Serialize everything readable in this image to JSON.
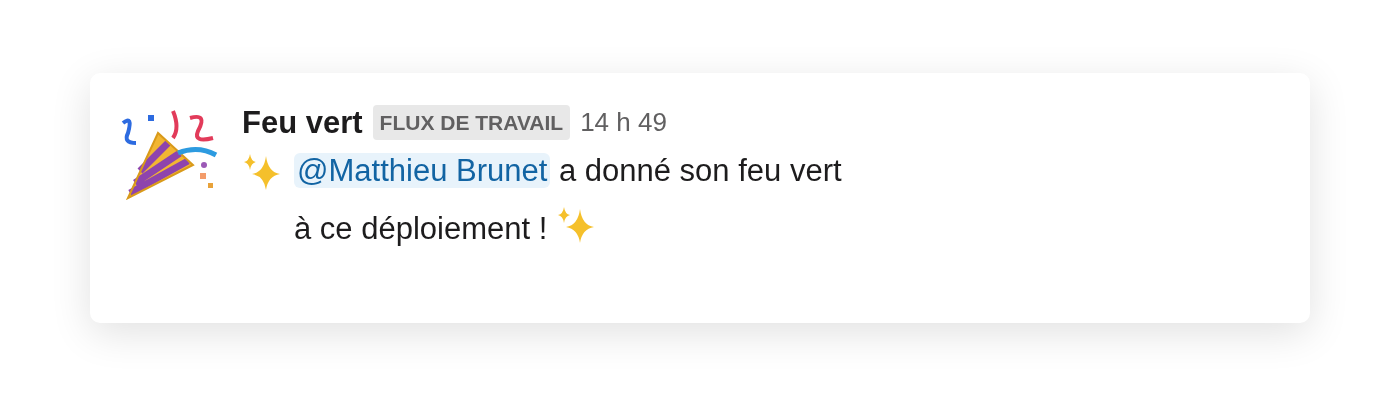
{
  "message": {
    "sender": "Feu vert",
    "badge": "FLUX DE TRAVAIL",
    "time": "14 h 49",
    "mention": "@Matthieu Brunet",
    "text_lines": [
      "a donné son feu vert",
      "à ce déploiement !"
    ]
  }
}
